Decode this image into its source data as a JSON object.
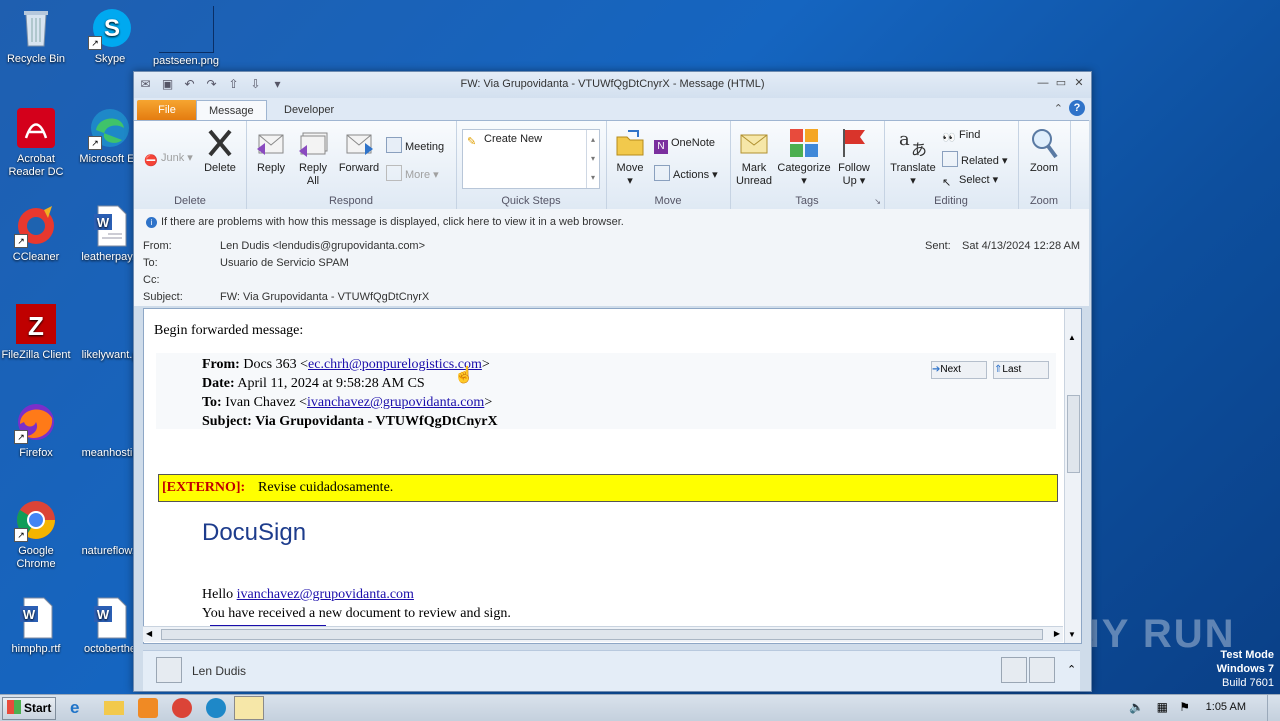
{
  "desktop": {
    "icons": [
      {
        "label": "Recycle Bin"
      },
      {
        "label": "Skype"
      },
      {
        "label": "pastseen.png"
      },
      {
        "label": "Acrobat Reader DC"
      },
      {
        "label": "Microsoft Ed"
      },
      {
        "label": "CCleaner"
      },
      {
        "label": "leatherpay.r"
      },
      {
        "label": "FileZilla Client"
      },
      {
        "label": "likelywant.p"
      },
      {
        "label": "Firefox"
      },
      {
        "label": "meanhostin"
      },
      {
        "label": "Google Chrome"
      },
      {
        "label": "natureflow.r"
      },
      {
        "label": "himphp.rtf"
      },
      {
        "label": "octoberthe"
      }
    ],
    "watermark": "ANY RUN",
    "test_mode": {
      "line1": "Test Mode",
      "line2": "Windows 7",
      "line3": "Build 7601"
    }
  },
  "window": {
    "title": "FW: Via Grupovidanta - VTUWfQgDtCnyrX - Message (HTML)",
    "tabs": {
      "file": "File",
      "message": "Message",
      "developer": "Developer"
    }
  },
  "ribbon": {
    "delete_group": {
      "junk": "Junk",
      "delete": "Delete",
      "label": "Delete"
    },
    "respond_group": {
      "reply": "Reply",
      "reply_all_1": "Reply",
      "reply_all_2": "All",
      "forward": "Forward",
      "meeting": "Meeting",
      "more": "More",
      "label": "Respond"
    },
    "quick_steps": {
      "create_new": "Create New",
      "label": "Quick Steps"
    },
    "move_group": {
      "move": "Move",
      "onenote": "OneNote",
      "actions": "Actions",
      "label": "Move"
    },
    "tags_group": {
      "mark_unread_1": "Mark",
      "mark_unread_2": "Unread",
      "categorize": "Categorize",
      "follow_up_1": "Follow",
      "follow_up_2": "Up",
      "label": "Tags"
    },
    "editing_group": {
      "translate": "Translate",
      "find": "Find",
      "related": "Related",
      "select": "Select",
      "label": "Editing"
    },
    "zoom_group": {
      "zoom": "Zoom",
      "label": "Zoom"
    }
  },
  "message": {
    "infobar": "If there are problems with how this message is displayed, click here to view it in a web browser.",
    "from_label": "From:",
    "from_value": "Len Dudis <lendudis@grupovidanta.com>",
    "to_label": "To:",
    "to_value": "Usuario de Servicio SPAM",
    "cc_label": "Cc:",
    "subject_label": "Subject:",
    "subject_value": "FW: Via Grupovidanta - VTUWfQgDtCnyrX",
    "sent_label": "Sent:",
    "sent_value": "Sat 4/13/2024 12:28 AM"
  },
  "body": {
    "begin": "Begin forwarded message:",
    "fwd_from_label": "From:",
    "fwd_from_name": "Docs 363 <",
    "fwd_from_email": "ec.chrh@ponpurelogistics.com",
    "fwd_from_close": ">",
    "fwd_date_label": "Date:",
    "fwd_date_value": "April 11, 2024 at 9:58:28 AM CS",
    "fwd_to_label": "To:",
    "fwd_to_name": "Ivan Chavez <",
    "fwd_to_email": "ivanchavez@grupovidanta.com",
    "fwd_to_close": ">",
    "fwd_subject_label": "Subject:",
    "fwd_subject_value": "Via Grupovidanta - VTUWfQgDtCnyrX",
    "next_btn": "Next",
    "last_btn": "Last",
    "externo_tag": "[EXTERNO]:",
    "externo_text": "Revise cuidadosamente.",
    "docusign": "DocuSign",
    "hello": "Hello",
    "hello_email": "ivanchavez@grupovidanta.com",
    "received": "You have received a new document to review and sign."
  },
  "people_pane": {
    "name": "Len Dudis"
  },
  "taskbar": {
    "start": "Start",
    "clock": "1:05 AM"
  }
}
